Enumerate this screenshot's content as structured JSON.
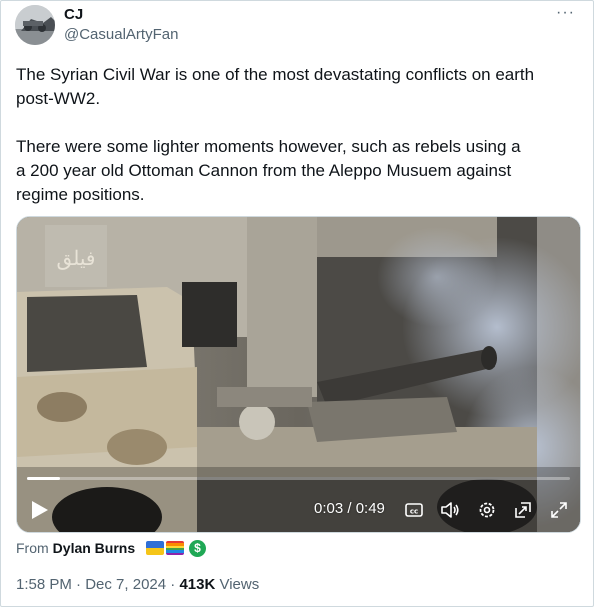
{
  "author": {
    "name": "CJ",
    "handle": "@CasualArtyFan",
    "avatar_icon": "avatar-photo-icon"
  },
  "more_icon": "more-dots-icon",
  "more_label": "···",
  "text": {
    "paragraph1": "The Syrian Civil War is one of the most devastating conflicts on earth\npost-WW2.",
    "paragraph2": "There were some lighter moments however, such as rebels using a\na 200 year old Ottoman Cannon from the Aleppo Musuem against\nregime positions."
  },
  "video": {
    "elapsed": "0:03",
    "separator": " / ",
    "duration": "0:49",
    "time_display": "0:03 / 0:49",
    "progress_fraction": 0.061,
    "controls": [
      "play-icon",
      "captions-icon",
      "volume-icon",
      "settings-icon",
      "picture-in-picture-icon",
      "fullscreen-icon"
    ]
  },
  "attribution": {
    "prefix": "From",
    "source_name": "Dylan Burns",
    "badges": [
      "ukraine-flag-icon",
      "rainbow-flag-icon",
      "dollar-coin-icon"
    ],
    "coin_glyph": "$"
  },
  "meta": {
    "time": "1:58 PM",
    "dot": " · ",
    "date": "Dec 7, 2024",
    "dot2": " · ",
    "views_count": "413K",
    "views_label": " Views"
  },
  "colors": {
    "text_primary": "#0f1419",
    "text_secondary": "#536471",
    "border": "#cfd9de"
  }
}
